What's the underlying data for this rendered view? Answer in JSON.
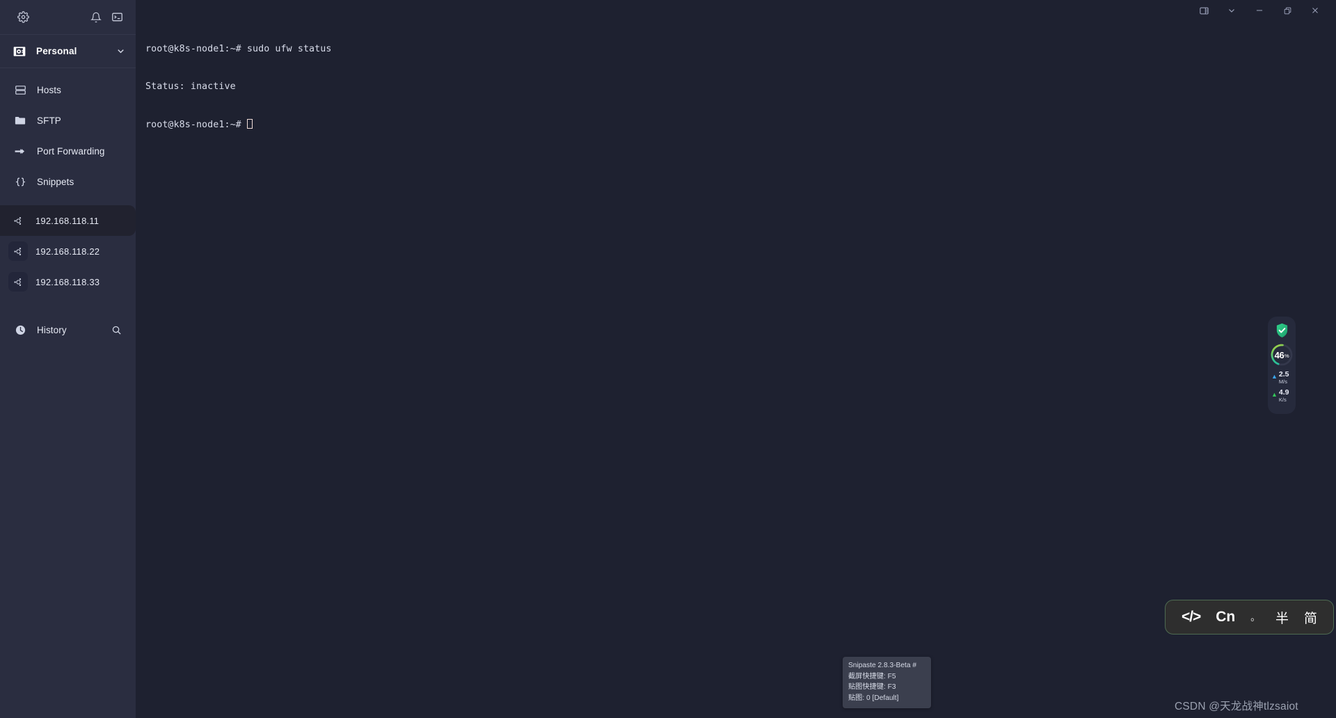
{
  "sidebar": {
    "toolbar": {
      "settings_icon": "gear-icon",
      "notifications_icon": "bell-icon",
      "terminal_icon": "terminal-icon"
    },
    "vault": {
      "label": "Personal",
      "icon": "vault-icon",
      "chevron": "chevron-down-icon"
    },
    "nav_items": [
      {
        "label": "Hosts",
        "icon": "server-icon"
      },
      {
        "label": "SFTP",
        "icon": "folder-icon"
      },
      {
        "label": "Port Forwarding",
        "icon": "arrow-forward-icon"
      },
      {
        "label": "Snippets",
        "icon": "braces-icon"
      }
    ],
    "hosts": [
      {
        "label": "192.168.118.11",
        "icon": "ubuntu-icon",
        "active": true
      },
      {
        "label": "192.168.118.22",
        "icon": "ubuntu-icon",
        "active": false
      },
      {
        "label": "192.168.118.33",
        "icon": "ubuntu-icon",
        "active": false
      }
    ],
    "history": {
      "label": "History",
      "icon": "clock-icon",
      "search_icon": "search-icon"
    }
  },
  "titlebar": {
    "controls": [
      {
        "name": "panel-toggle",
        "icon": "sidebar-panel-icon"
      },
      {
        "name": "dropdown",
        "icon": "chevron-down-icon"
      },
      {
        "name": "minimize",
        "icon": "minimize-icon"
      },
      {
        "name": "maximize",
        "icon": "restore-icon"
      },
      {
        "name": "close",
        "icon": "close-icon"
      }
    ]
  },
  "terminal": {
    "lines": [
      "root@k8s-node1:~# sudo ufw status",
      "Status: inactive"
    ],
    "prompt": "root@k8s-node1:~# ",
    "cursor": "block-outline-cursor"
  },
  "net_widget": {
    "shield_status": "secure",
    "shield_icon": "shield-check-icon",
    "cpu_percent": "46",
    "percent_symbol": "%",
    "ring_value": 46,
    "download": {
      "arrow": "▲",
      "value": "2.5",
      "unit": "M/s",
      "color": "#3aa6f0"
    },
    "upload": {
      "arrow": "▲",
      "value": "4.9",
      "unit": "K/s",
      "color": "#34c759"
    }
  },
  "snipaste_tooltip": {
    "lines": [
      "Snipaste 2.8.3-Beta #",
      "截屏快捷键: F5",
      "贴图快捷键: F3",
      "贴图: 0 [Default]"
    ]
  },
  "ime_bar": {
    "items": [
      {
        "label": "</>",
        "name": "ime-code-mode"
      },
      {
        "label": "Cn",
        "name": "ime-language-toggle"
      },
      {
        "label": "。",
        "name": "ime-punctuation-toggle"
      },
      {
        "label": "半",
        "name": "ime-width-toggle"
      },
      {
        "label": "简",
        "name": "ime-simplified-toggle"
      }
    ]
  },
  "watermark": {
    "text": "CSDN @天龙战神tlzsaiot"
  },
  "colors": {
    "sidebar_bg": "#2a2d40",
    "terminal_bg": "#1e2130",
    "active_host_bg": "#21222f",
    "accent_green": "#34c759",
    "accent_blue": "#3aa6f0"
  }
}
